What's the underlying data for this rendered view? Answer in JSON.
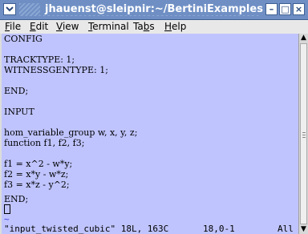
{
  "window": {
    "title": "jhauenst@sleipnir:~/BertiniExamples",
    "controls": {
      "minimize": "–",
      "maximize": "□",
      "close": "×"
    }
  },
  "menubar": [
    {
      "label": "File",
      "mnemonic": "F",
      "rest": "ile"
    },
    {
      "label": "Edit",
      "mnemonic": "E",
      "rest": "dit"
    },
    {
      "label": "View",
      "mnemonic": "V",
      "rest": "iew"
    },
    {
      "label": "Terminal",
      "mnemonic": "T",
      "rest": "erminal"
    },
    {
      "label": "Tabs",
      "pre": "Ta",
      "mnemonic": "b",
      "rest": "s"
    },
    {
      "label": "Help",
      "mnemonic": "H",
      "rest": "elp"
    }
  ],
  "terminal": {
    "lines": [
      "CONFIG",
      "",
      "TRACKTYPE: 1;",
      "WITNESSGENTYPE: 1;",
      "",
      "END;",
      "",
      "INPUT",
      "",
      "hom_variable_group w, x, y, z;",
      "function f1, f2, f3;",
      "",
      "f1 = x^2 - w*y;",
      "f2 = x*y - w*z;",
      "f3 = x*z - y^2;",
      "",
      "END;"
    ],
    "tilde": "~",
    "status": {
      "file": "\"input_twisted_cubic\" 18L, 163C",
      "position": "18,0-1",
      "scroll": "All"
    }
  },
  "colors": {
    "titlebar": "#6f8fc4",
    "terminal_bg": "#bfc4ff",
    "tilde": "#3a3adf"
  }
}
